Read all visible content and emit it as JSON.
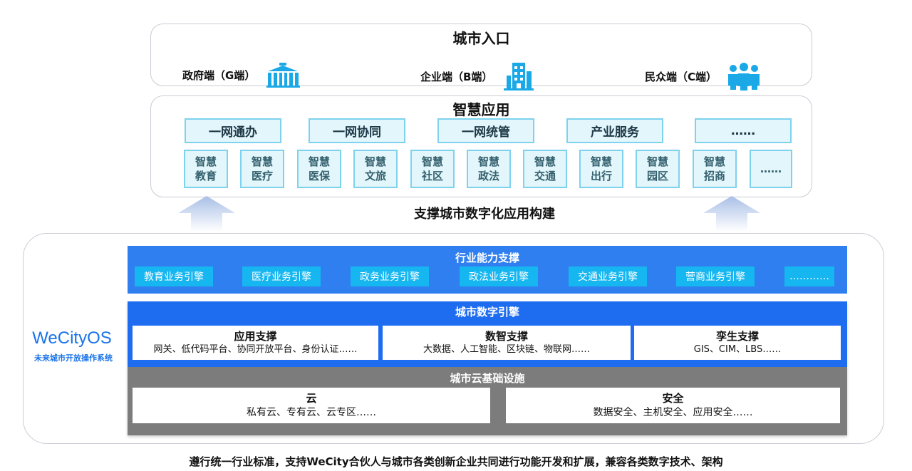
{
  "entrance": {
    "title": "城市入口",
    "items": [
      {
        "label": "政府端（G端）",
        "icon": "government-building-icon"
      },
      {
        "label": "企业端（B端）",
        "icon": "office-tower-icon"
      },
      {
        "label": "民众端（C端）",
        "icon": "people-group-icon"
      }
    ]
  },
  "apps": {
    "title": "智慧应用",
    "categories": [
      "一网通办",
      "一网协同",
      "一网统管",
      "产业服务",
      "……"
    ],
    "items": [
      [
        "智慧",
        "教育"
      ],
      [
        "智慧",
        "医疗"
      ],
      [
        "智慧",
        "医保"
      ],
      [
        "智慧",
        "文旅"
      ],
      [
        "智慧",
        "社区"
      ],
      [
        "智慧",
        "政法"
      ],
      [
        "智慧",
        "交通"
      ],
      [
        "智慧",
        "出行"
      ],
      [
        "智慧",
        "园区"
      ],
      [
        "智慧",
        "招商"
      ],
      [
        "……",
        ""
      ]
    ]
  },
  "support_caption": "支撑城市数字化应用构建",
  "os": {
    "name": "WeCityOS",
    "subtitle": "未来城市开放操作系统"
  },
  "industry": {
    "title": "行业能力支撑",
    "engines": [
      "教育业务引擎",
      "医疗业务引擎",
      "政务业务引擎",
      "政法业务引擎",
      "交通业务引擎",
      "营商业务引擎",
      "…………"
    ]
  },
  "digital_engine": {
    "title": "城市数字引擎",
    "cards": [
      {
        "title": "应用支撑",
        "desc": "网关、低代码平台、协同开放平台、身份认证……"
      },
      {
        "title": "数智支撑",
        "desc": "大数据、人工智能、区块链、物联网……"
      },
      {
        "title": "孪生支撑",
        "desc": "GIS、CIM、LBS……"
      }
    ]
  },
  "cloud_infra": {
    "title": "城市云基础设施",
    "cards": [
      {
        "title": "云",
        "desc": "私有云、专有云、云专区……"
      },
      {
        "title": "安全",
        "desc": "数据安全、主机安全、应用安全……"
      }
    ]
  },
  "footer": "遵行统一行业标准，支持WeCity合伙人与城市各类创新企业共同进行功能开发和扩展，兼容各类数字技术、架构",
  "colors": {
    "app_fill": "#e2f6fb",
    "app_border": "#7fd2ee",
    "industry_bg": "#2f7ff0",
    "engine_bg": "#16b6f0",
    "digital_bg": "#1e6cf0",
    "cloud_bg": "#7c7c7c",
    "brand_blue": "#1a73e8",
    "icon_teal": "#1aa9e6"
  }
}
